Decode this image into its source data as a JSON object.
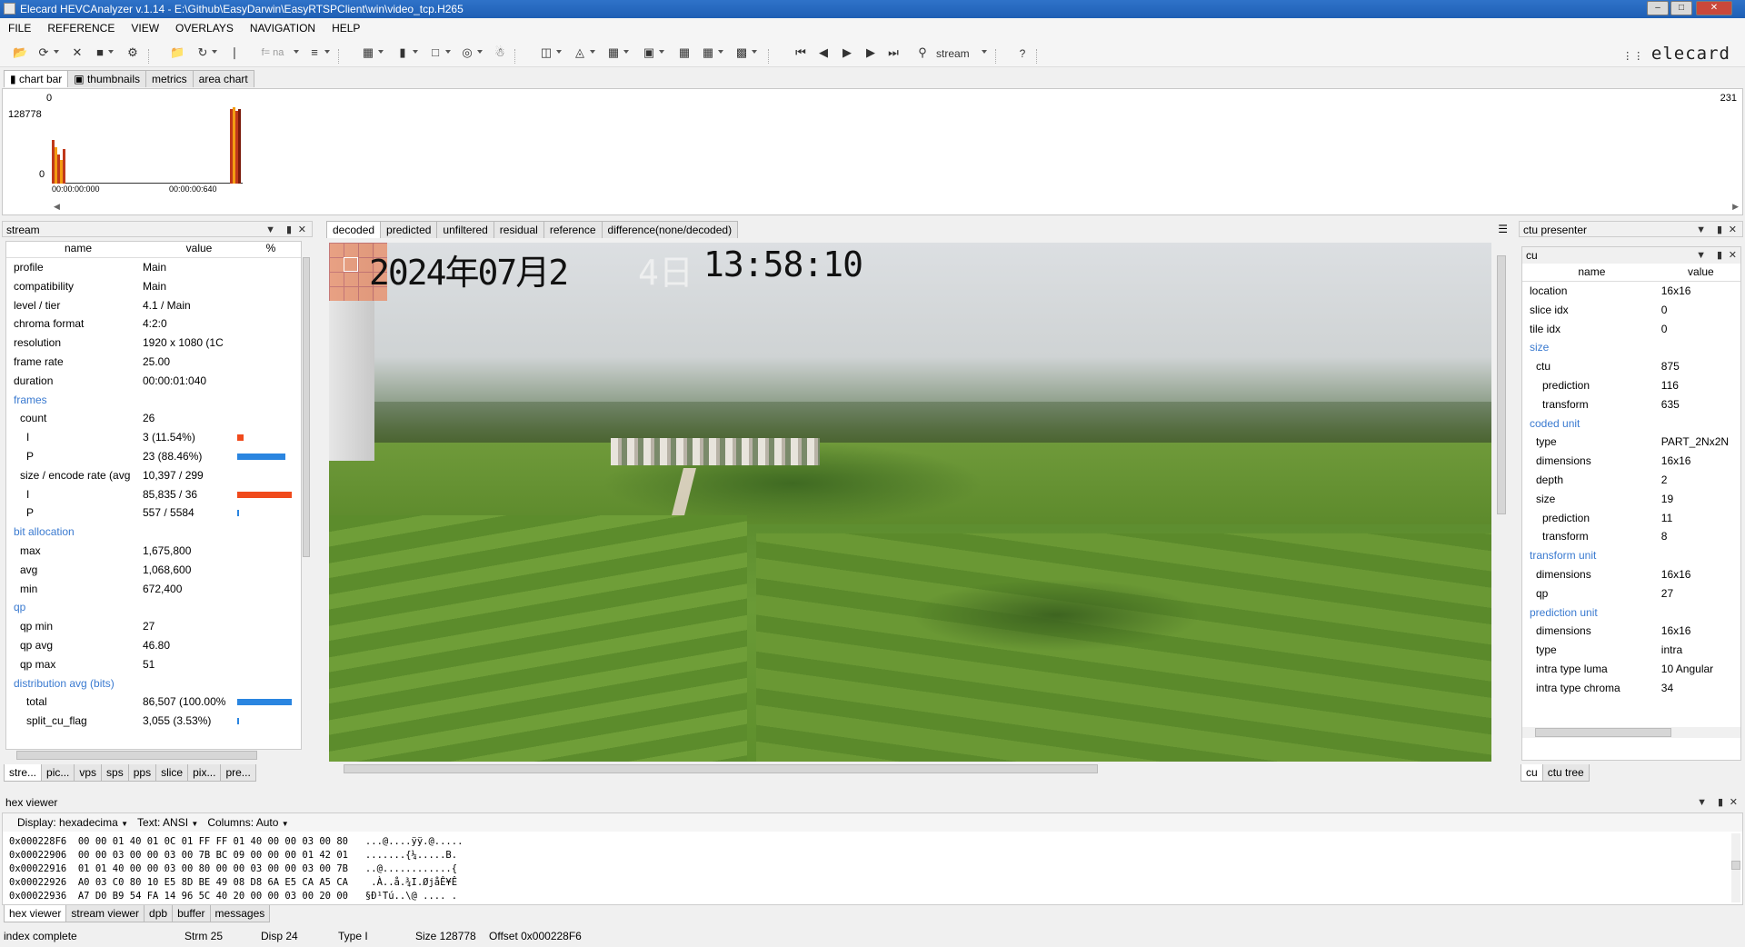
{
  "window": {
    "title": "Elecard HEVCAnalyzer v.1.14 - E:\\Github\\EasyDarwin\\EasyRTSPClient\\win\\video_tcp.H265"
  },
  "menu": [
    "FILE",
    "REFERENCE",
    "VIEW",
    "OVERLAYS",
    "NAVIGATION",
    "HELP"
  ],
  "toolbar": {
    "stream_label": "stream",
    "help_label": "?",
    "formula_label": "f= na",
    "logo": "elecard"
  },
  "top_tabs": [
    "chart bar",
    "thumbnails",
    "metrics",
    "area chart"
  ],
  "chart": {
    "y_top": "128778",
    "y_bottom": "0",
    "top_zero": "0",
    "x_start": "00:00:00:000",
    "x_mid": "00:00:00:640",
    "right_count": "231"
  },
  "stream_panel": {
    "title": "stream",
    "headers": [
      "name",
      "value",
      "%"
    ],
    "rows": [
      {
        "name": "profile",
        "value": "Main",
        "indent": 0,
        "section": false
      },
      {
        "name": "compatibility",
        "value": "Main",
        "indent": 0,
        "section": false
      },
      {
        "name": "level / tier",
        "value": "4.1 / Main",
        "indent": 0,
        "section": false
      },
      {
        "name": "chroma format",
        "value": "4:2:0",
        "indent": 0,
        "section": false
      },
      {
        "name": "resolution",
        "value": "1920 x 1080 (1C",
        "indent": 0,
        "section": false
      },
      {
        "name": "frame rate",
        "value": "25.00",
        "indent": 0,
        "section": false
      },
      {
        "name": "duration",
        "value": "00:00:01:040",
        "indent": 0,
        "section": false
      },
      {
        "name": "frames",
        "value": "",
        "indent": 0,
        "section": true
      },
      {
        "name": "count",
        "value": "26",
        "indent": 1,
        "section": false
      },
      {
        "name": "I",
        "value": "3 (11.54%)",
        "indent": 2,
        "section": false,
        "bar": 0.1154,
        "barColor": "#f04a1c"
      },
      {
        "name": "P",
        "value": "23 (88.46%)",
        "indent": 2,
        "section": false,
        "bar": 0.8846,
        "barColor": "#2a85e0"
      },
      {
        "name": "size / encode rate (avg",
        "value": "10,397 / 299",
        "indent": 1,
        "section": false
      },
      {
        "name": "I",
        "value": "85,835 / 36",
        "indent": 2,
        "section": false,
        "bar": 1.0,
        "barColor": "#f04a1c"
      },
      {
        "name": "P",
        "value": "557 / 5584",
        "indent": 2,
        "section": false,
        "bar": 0.01,
        "barColor": "#2a85e0"
      },
      {
        "name": "bit allocation",
        "value": "",
        "indent": 0,
        "section": true
      },
      {
        "name": "max",
        "value": "1,675,800",
        "indent": 1,
        "section": false
      },
      {
        "name": "avg",
        "value": "1,068,600",
        "indent": 1,
        "section": false
      },
      {
        "name": "min",
        "value": "672,400",
        "indent": 1,
        "section": false
      },
      {
        "name": "qp",
        "value": "",
        "indent": 0,
        "section": true
      },
      {
        "name": "qp min",
        "value": "27",
        "indent": 1,
        "section": false
      },
      {
        "name": "qp avg",
        "value": "46.80",
        "indent": 1,
        "section": false
      },
      {
        "name": "qp max",
        "value": "51",
        "indent": 1,
        "section": false
      },
      {
        "name": "distribution avg (bits)",
        "value": "",
        "indent": 0,
        "section": true
      },
      {
        "name": "total",
        "value": "86,507 (100.00%",
        "indent": 2,
        "section": false,
        "bar": 1.0,
        "barColor": "#2a85e0"
      },
      {
        "name": "split_cu_flag",
        "value": "3,055 (3.53%)",
        "indent": 2,
        "section": false,
        "bar": 0.035,
        "barColor": "#2a85e0"
      }
    ],
    "bottom_tabs": [
      "stre...",
      "pic...",
      "vps",
      "sps",
      "pps",
      "slice",
      "pix...",
      "pre..."
    ]
  },
  "video_panel": {
    "tabs": [
      "decoded",
      "predicted",
      "unfiltered",
      "residual",
      "reference",
      "difference(none/decoded)"
    ],
    "timestamp_date": "2024年07月2",
    "timestamp_day": "4日",
    "timestamp_time": "13:58:10"
  },
  "ctu_panel": {
    "title": "ctu presenter",
    "sub_title": "cu",
    "headers": [
      "name",
      "value"
    ],
    "rows": [
      {
        "name": "location",
        "value": "16x16",
        "indent": 0,
        "section": false
      },
      {
        "name": "slice idx",
        "value": "0",
        "indent": 0,
        "section": false
      },
      {
        "name": "tile idx",
        "value": "0",
        "indent": 0,
        "section": false
      },
      {
        "name": "size",
        "value": "",
        "indent": 0,
        "section": true
      },
      {
        "name": "ctu",
        "value": "875",
        "indent": 1,
        "section": false
      },
      {
        "name": "prediction",
        "value": "116",
        "indent": 2,
        "section": false
      },
      {
        "name": "transform",
        "value": "635",
        "indent": 2,
        "section": false
      },
      {
        "name": "coded unit",
        "value": "",
        "indent": 0,
        "section": true
      },
      {
        "name": "type",
        "value": "PART_2Nx2N",
        "indent": 1,
        "section": false
      },
      {
        "name": "dimensions",
        "value": "16x16",
        "indent": 1,
        "section": false
      },
      {
        "name": "depth",
        "value": "2",
        "indent": 1,
        "section": false
      },
      {
        "name": "size",
        "value": "19",
        "indent": 1,
        "section": false
      },
      {
        "name": "prediction",
        "value": "11",
        "indent": 2,
        "section": false
      },
      {
        "name": "transform",
        "value": "8",
        "indent": 2,
        "section": false
      },
      {
        "name": "transform unit",
        "value": "",
        "indent": 0,
        "section": true
      },
      {
        "name": "dimensions",
        "value": "16x16",
        "indent": 1,
        "section": false
      },
      {
        "name": "qp",
        "value": "27",
        "indent": 1,
        "section": false
      },
      {
        "name": "prediction unit",
        "value": "",
        "indent": 0,
        "section": true
      },
      {
        "name": "dimensions",
        "value": "16x16",
        "indent": 1,
        "section": false
      },
      {
        "name": "type",
        "value": "intra",
        "indent": 1,
        "section": false
      },
      {
        "name": "intra type luma",
        "value": "10 Angular",
        "indent": 1,
        "section": false
      },
      {
        "name": "intra type chroma",
        "value": "34",
        "indent": 1,
        "section": false
      }
    ],
    "bottom_tabs": [
      "cu",
      "ctu tree"
    ]
  },
  "hex_panel": {
    "title": "hex viewer",
    "display_label": "Display:",
    "display_value": "hexadecima",
    "text_label": "Text:",
    "text_value": "ANSI",
    "columns_label": "Columns:",
    "columns_value": "Auto",
    "lines": [
      "0x000228F6  00 00 01 40 01 0C 01 FF FF 01 40 00 00 03 00 80   ...@....ÿÿ.@.....",
      "0x00022906  00 00 03 00 00 03 00 7B BC 09 00 00 00 01 42 01   .......{¼.....B.",
      "0x00022916  01 01 40 00 00 03 00 80 00 00 03 00 00 03 00 7B   ..@............{",
      "0x00022926  A0 03 C0 80 10 E5 8D BE 49 08 D8 6A E5 CA A5 CA    .À..å.¾I.ØjåÊ¥Ê",
      "0x00022936  A7 D0 B9 54 FA 14 96 5C 40 20 00 00 03 00 20 00   §Ð¹Tú..\\@ .... ."
    ],
    "bottom_tabs": [
      "hex viewer",
      "stream viewer",
      "dpb",
      "buffer",
      "messages"
    ]
  },
  "statusbar": {
    "status": "index complete",
    "strm": "Strm 25",
    "disp": "Disp 24",
    "type": "Type I",
    "size": "Size 128778",
    "offset": "Offset 0x000228F6"
  }
}
